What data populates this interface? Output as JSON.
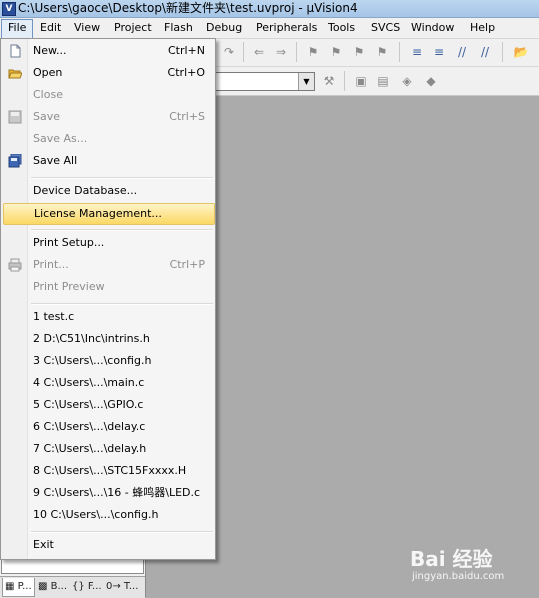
{
  "window": {
    "title": "C:\\Users\\gaoce\\Desktop\\新建文件夹\\test.uvproj - µVision4",
    "app_icon": "V"
  },
  "menubar": [
    {
      "label": "File",
      "name": "menu-file"
    },
    {
      "label": "Edit",
      "name": "menu-edit"
    },
    {
      "label": "View",
      "name": "menu-view"
    },
    {
      "label": "Project",
      "name": "menu-project"
    },
    {
      "label": "Flash",
      "name": "menu-flash"
    },
    {
      "label": "Debug",
      "name": "menu-debug"
    },
    {
      "label": "Peripherals",
      "name": "menu-peripherals"
    },
    {
      "label": "Tools",
      "name": "menu-tools"
    },
    {
      "label": "SVCS",
      "name": "menu-svcs"
    },
    {
      "label": "Window",
      "name": "menu-window"
    },
    {
      "label": "Help",
      "name": "menu-help"
    }
  ],
  "file_menu": {
    "items": [
      {
        "label": "New...",
        "shortcut": "Ctrl+N",
        "icon": "new-file-icon",
        "disabled": false
      },
      {
        "label": "Open",
        "shortcut": "Ctrl+O",
        "icon": "open-folder-icon",
        "disabled": false
      },
      {
        "label": "Close",
        "shortcut": "",
        "icon": "",
        "disabled": true
      },
      {
        "label": "Save",
        "shortcut": "Ctrl+S",
        "icon": "save-icon",
        "disabled": true
      },
      {
        "label": "Save As...",
        "shortcut": "",
        "icon": "",
        "disabled": true
      },
      {
        "label": "Save All",
        "shortcut": "",
        "icon": "save-all-icon",
        "disabled": false
      },
      {
        "label": "Device Database...",
        "shortcut": "",
        "icon": "",
        "disabled": false
      },
      {
        "label": "License Management...",
        "shortcut": "",
        "icon": "",
        "disabled": false,
        "highlighted": true
      },
      {
        "label": "Print Setup...",
        "shortcut": "",
        "icon": "",
        "disabled": false
      },
      {
        "label": "Print...",
        "shortcut": "Ctrl+P",
        "icon": "print-icon",
        "disabled": true
      },
      {
        "label": "Print Preview",
        "shortcut": "",
        "icon": "",
        "disabled": true
      }
    ],
    "recent_files": [
      "1 test.c",
      "2 D:\\C51\\Inc\\intrins.h",
      "3 C:\\Users\\...\\config.h",
      "4 C:\\Users\\...\\main.c",
      "5 C:\\Users\\...\\GPIO.c",
      "6 C:\\Users\\...\\delay.c",
      "7 C:\\Users\\...\\delay.h",
      "8 C:\\Users\\...\\STC15Fxxxx.H",
      "9 C:\\Users\\...\\16 - 蜂鸣器\\LED.c",
      "10 C:\\Users\\...\\config.h"
    ],
    "exit_label": "Exit"
  },
  "project_panel": {
    "tabs": [
      {
        "label": "P...",
        "icon": "project-icon"
      },
      {
        "label": "B...",
        "icon": "books-icon"
      },
      {
        "label": "{} F...",
        "icon": "functions-icon"
      },
      {
        "label": "0→ T...",
        "icon": "templates-icon"
      }
    ]
  },
  "watermark": {
    "brand": "Bai 经验",
    "url": "jingyan.baidu.com"
  },
  "colors": {
    "highlight": "#fbd865",
    "titlebar": "#bcd6ef",
    "workspace": "#ababab"
  }
}
